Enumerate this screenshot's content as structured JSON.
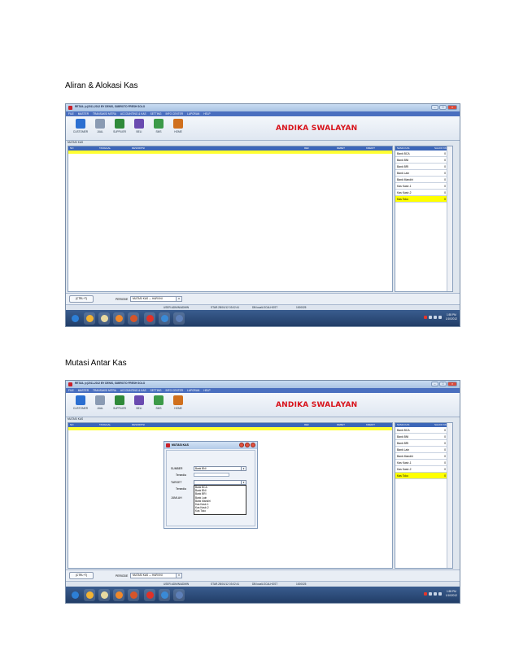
{
  "section1": {
    "caption": "Aliran & Alokasi Kas"
  },
  "section2": {
    "caption": "Mutasi Antar Kas"
  },
  "window": {
    "title": "RETAIL (c)2011-2012 BY DENIS, SUBROTO FRESH SOLO",
    "menu": [
      "FILE",
      "MASTER",
      "TRANSAKSI MITRA",
      "ACCOUNTING & KAS",
      "SETTING",
      "INFO CENTER",
      "LAPORAN",
      "HELP"
    ],
    "toolbar": [
      "CUSTOMER",
      "JUAL",
      "SUPPLIER",
      "BELI",
      "SMS",
      "HOME"
    ],
    "brand": "ANDIKA SWALAYAN",
    "section_label": "MUTASI KAS",
    "grid_columns": [
      "NO",
      "TANGGAL",
      "DESKRIPSI",
      "REF",
      "DEBET",
      "KREDIT"
    ],
    "side_columns": [
      "NAMA KAS",
      "SALDO KK"
    ],
    "accounts": [
      {
        "name": "Bank BCA",
        "saldo": "0"
      },
      {
        "name": "Bank BNI",
        "saldo": "0"
      },
      {
        "name": "Bank BRI",
        "saldo": "0"
      },
      {
        "name": "Bank Lain",
        "saldo": "0"
      },
      {
        "name": "Bank Mandiri",
        "saldo": "0"
      },
      {
        "name": "Kas Kasir-1",
        "saldo": "0"
      },
      {
        "name": "Kas Kasir-2",
        "saldo": "0"
      },
      {
        "name": "Kas Toko",
        "saldo": "0"
      }
    ],
    "selected_account_index": 7,
    "bottom": {
      "button": "(CTRL+T)",
      "period_label": "PERIODE",
      "period_value": "MUTASI KAS --- HARI INI"
    },
    "status": [
      "USER:ADMIN/ADMIN",
      "STAR.2B/01/12 03:02:41",
      "DB:localLOCALHOST",
      "1000025"
    ],
    "clock": {
      "time": "1:55 PM",
      "date": "1/10/2012"
    }
  },
  "dialog": {
    "title": "MUTASI KAS",
    "sumber_label": "SUMBER",
    "sumber_value": "Bank BNI",
    "tersedia_label": "Tersedia",
    "target_label": "TARGET",
    "target_tersedia_label": "Tersedia",
    "jumlah_label": "JUMLAH",
    "target_options": [
      "Bank BCA",
      "Bank BNI",
      "Bank BRI",
      "Bank Lain",
      "Bank Mandiri",
      "Kas Kasir-1",
      "Kas Kasir-2",
      "Kas Toko"
    ]
  },
  "colors": {
    "brand": "#d8121a",
    "header": "#3c66b8",
    "highlight": "#ffff00"
  }
}
